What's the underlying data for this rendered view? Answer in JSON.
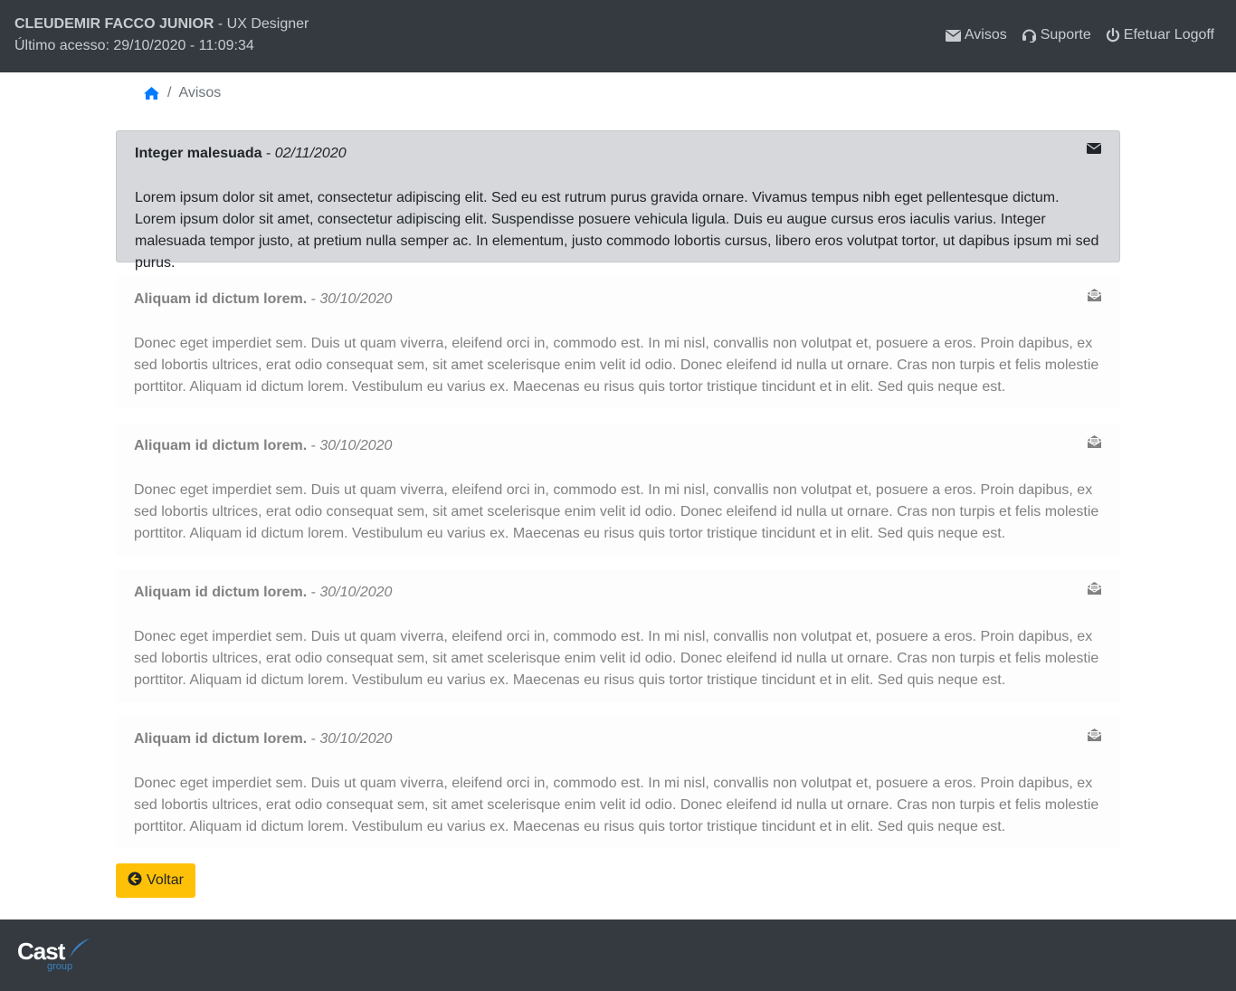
{
  "header": {
    "user_name": "CLEUDEMIR FACCO JUNIOR",
    "user_role": " - UX Designer",
    "last_access": "Último acesso: 29/10/2020 - 11:09:34",
    "nav": {
      "avisos": "Avisos",
      "suporte": "Suporte",
      "logoff": "Efetuar Logoff"
    }
  },
  "breadcrumb": {
    "separator": "/",
    "current": "Avisos"
  },
  "notices": [
    {
      "title": "Integer malesuada",
      "date_sep": " - ",
      "date": "02/11/2020",
      "body": "Lorem ipsum dolor sit amet, consectetur adipiscing elit. Sed eu est rutrum purus gravida ornare. Vivamus tempus nibh eget pellentesque dictum. Lorem ipsum dolor sit amet, consectetur adipiscing elit. Suspendisse posuere vehicula ligula. Duis eu augue cursus eros iaculis varius. Integer malesuada tempor justo, at pretium nulla semper ac. In elementum, justo commodo lobortis cursus, libero eros volutpat tortor, ut dapibus ipsum mi sed purus.",
      "status": "unread",
      "icon": "envelope-icon"
    },
    {
      "title": "Aliquam id dictum lorem.",
      "date_sep": " - ",
      "date": "30/10/2020",
      "body": "Donec eget imperdiet sem. Duis ut quam viverra, eleifend orci in, commodo est. In mi nisl, convallis non volutpat et, posuere a eros. Proin dapibus, ex sed lobortis ultrices, erat odio consequat sem, sit amet scelerisque enim velit id odio. Donec eleifend id nulla ut ornare. Cras non turpis et felis molestie porttitor. Aliquam id dictum lorem. Vestibulum eu varius ex. Maecenas eu risus quis tortor tristique tincidunt et in elit. Sed quis neque est.",
      "status": "read",
      "icon": "envelope-open-icon"
    },
    {
      "title": "Aliquam id dictum lorem.",
      "date_sep": " - ",
      "date": "30/10/2020",
      "body": "Donec eget imperdiet sem. Duis ut quam viverra, eleifend orci in, commodo est. In mi nisl, convallis non volutpat et, posuere a eros. Proin dapibus, ex sed lobortis ultrices, erat odio consequat sem, sit amet scelerisque enim velit id odio. Donec eleifend id nulla ut ornare. Cras non turpis et felis molestie porttitor. Aliquam id dictum lorem. Vestibulum eu varius ex. Maecenas eu risus quis tortor tristique tincidunt et in elit. Sed quis neque est.",
      "status": "read",
      "icon": "envelope-open-icon"
    },
    {
      "title": "Aliquam id dictum lorem.",
      "date_sep": " - ",
      "date": "30/10/2020",
      "body": "Donec eget imperdiet sem. Duis ut quam viverra, eleifend orci in, commodo est. In mi nisl, convallis non volutpat et, posuere a eros. Proin dapibus, ex sed lobortis ultrices, erat odio consequat sem, sit amet scelerisque enim velit id odio. Donec eleifend id nulla ut ornare. Cras non turpis et felis molestie porttitor. Aliquam id dictum lorem. Vestibulum eu varius ex. Maecenas eu risus quis tortor tristique tincidunt et in elit. Sed quis neque est.",
      "status": "read",
      "icon": "envelope-open-icon"
    },
    {
      "title": "Aliquam id dictum lorem.",
      "date_sep": " - ",
      "date": "30/10/2020",
      "body": "Donec eget imperdiet sem. Duis ut quam viverra, eleifend orci in, commodo est. In mi nisl, convallis non volutpat et, posuere a eros. Proin dapibus, ex sed lobortis ultrices, erat odio consequat sem, sit amet scelerisque enim velit id odio. Donec eleifend id nulla ut ornare. Cras non turpis et felis molestie porttitor. Aliquam id dictum lorem. Vestibulum eu varius ex. Maecenas eu risus quis tortor tristique tincidunt et in elit. Sed quis neque est.",
      "status": "read",
      "icon": "envelope-open-icon"
    }
  ],
  "actions": {
    "back_label": "Voltar"
  },
  "footer": {
    "logo_text": "Cast",
    "logo_sub": "group"
  },
  "colors": {
    "topbar": "#343a40",
    "unread_bg": "#d6d8db",
    "read_bg": "#fdfdfe",
    "back_button": "#ffc107",
    "home_icon": "#007bff"
  }
}
